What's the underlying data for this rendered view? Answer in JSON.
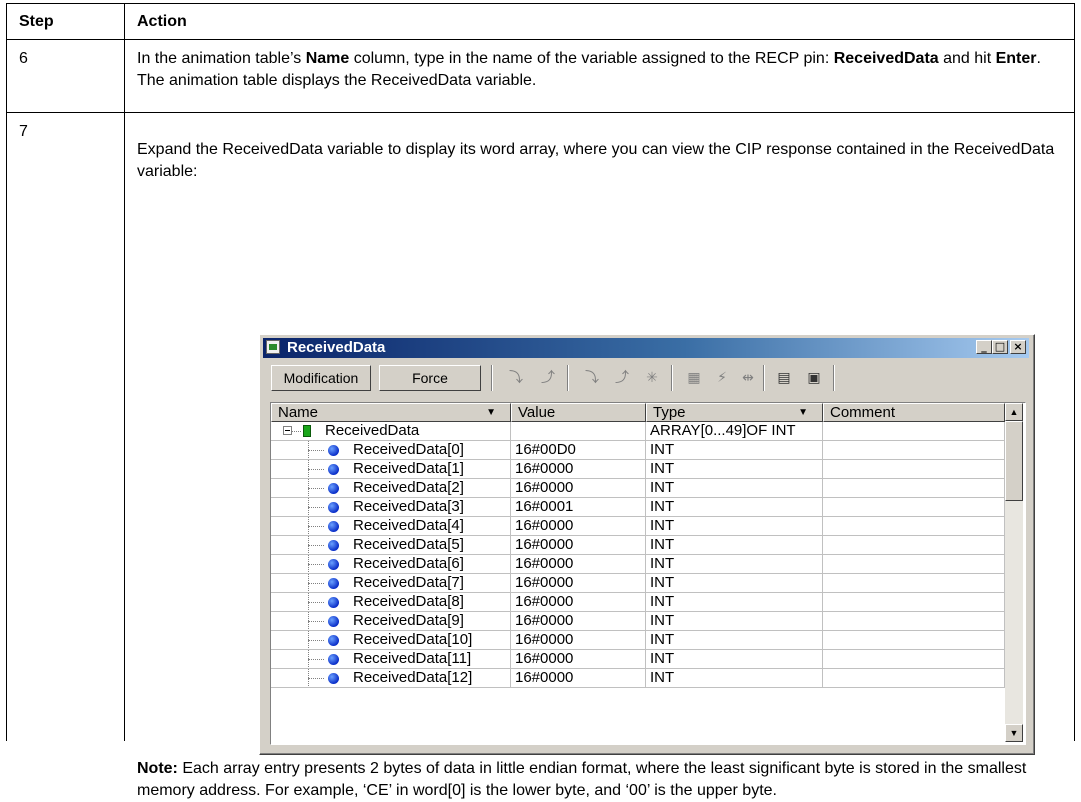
{
  "table": {
    "headers": {
      "step": "Step",
      "action": "Action"
    }
  },
  "row6": {
    "step": "6",
    "text1": "In the animation table’s ",
    "bold1": "Name",
    "text2": " column, type in the name of the variable assigned to the RECP pin: ",
    "bold2": "ReceivedData",
    "text3": " and hit ",
    "bold3": "Enter",
    "text4": ". The animation table displays the ReceivedData variable."
  },
  "row7": {
    "step": "7",
    "intro": "Expand the ReceivedData variable to display its word array, where you can view the CIP response contained in the ReceivedData variable:",
    "note_label": "Note:",
    "note_text": " Each array entry presents 2 bytes of data in little endian format, where the least significant byte is stored in the smallest memory address. For example, ‘CE’ in word[0] is the lower byte, and ‘00’ is the upper byte."
  },
  "window": {
    "title": "ReceivedData",
    "controls": {
      "minimize": "_",
      "maximize": "□",
      "close": "×"
    },
    "toolbar": {
      "modification": "Modification",
      "force": "Force"
    },
    "columns": {
      "name": "Name",
      "value": "Value",
      "type": "Type",
      "comment": "Comment"
    },
    "root": {
      "name": "ReceivedData",
      "value": "",
      "type": "ARRAY[0...49]OF INT",
      "comment": ""
    },
    "rows": [
      {
        "name": "ReceivedData[0]",
        "value": "16#00D0",
        "type": "INT",
        "comment": ""
      },
      {
        "name": "ReceivedData[1]",
        "value": "16#0000",
        "type": "INT",
        "comment": ""
      },
      {
        "name": "ReceivedData[2]",
        "value": "16#0000",
        "type": "INT",
        "comment": ""
      },
      {
        "name": "ReceivedData[3]",
        "value": "16#0001",
        "type": "INT",
        "comment": ""
      },
      {
        "name": "ReceivedData[4]",
        "value": "16#0000",
        "type": "INT",
        "comment": ""
      },
      {
        "name": "ReceivedData[5]",
        "value": "16#0000",
        "type": "INT",
        "comment": ""
      },
      {
        "name": "ReceivedData[6]",
        "value": "16#0000",
        "type": "INT",
        "comment": ""
      },
      {
        "name": "ReceivedData[7]",
        "value": "16#0000",
        "type": "INT",
        "comment": ""
      },
      {
        "name": "ReceivedData[8]",
        "value": "16#0000",
        "type": "INT",
        "comment": ""
      },
      {
        "name": "ReceivedData[9]",
        "value": "16#0000",
        "type": "INT",
        "comment": ""
      },
      {
        "name": "ReceivedData[10]",
        "value": "16#0000",
        "type": "INT",
        "comment": ""
      },
      {
        "name": "ReceivedData[11]",
        "value": "16#0000",
        "type": "INT",
        "comment": ""
      },
      {
        "name": "ReceivedData[12]",
        "value": "16#0000",
        "type": "INT",
        "comment": ""
      }
    ]
  }
}
